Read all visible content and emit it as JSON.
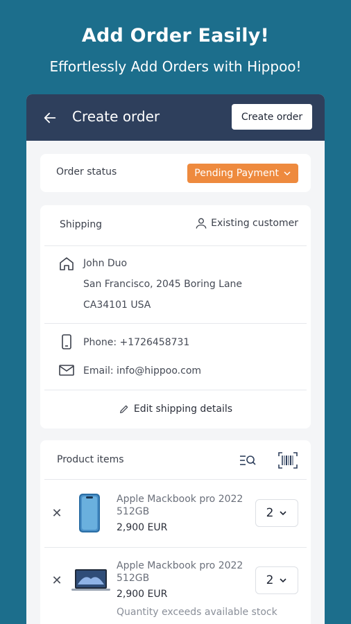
{
  "promo": {
    "title": "Add Order Easily!",
    "subtitle": "Effortlessly Add Orders with Hippoo!"
  },
  "appbar": {
    "back_icon": "arrow-left-icon",
    "title": "Create order",
    "create_button": "Create order"
  },
  "order_status": {
    "label": "Order status",
    "value": "Pending Payment",
    "color": "#ee8a3e"
  },
  "shipping": {
    "title": "Shipping",
    "existing_customer": "Existing customer",
    "name": "John Duo",
    "address_line1": "San Francisco, 2045 Boring Lane",
    "address_line2": "CA34101 USA",
    "phone": "Phone: +1726458731",
    "email": "Email: info@hippoo.com",
    "edit_link": "Edit shipping details"
  },
  "products": {
    "title": "Product items",
    "items": [
      {
        "name_line1": "Apple Mackbook pro 2022",
        "name_line2": "512GB",
        "price": "2,900 EUR",
        "quantity": "2",
        "thumb": "iphone-image"
      },
      {
        "name_line1": "Apple Mackbook pro 2022",
        "name_line2": "512GB",
        "price": "2,900 EUR",
        "quantity": "2",
        "thumb": "macbook-image",
        "warning": "Quantity exceeds available stock"
      }
    ]
  },
  "colors": {
    "background": "#1c6e8c",
    "appbar": "#2e3f5c",
    "accent": "#ee8a3e"
  }
}
